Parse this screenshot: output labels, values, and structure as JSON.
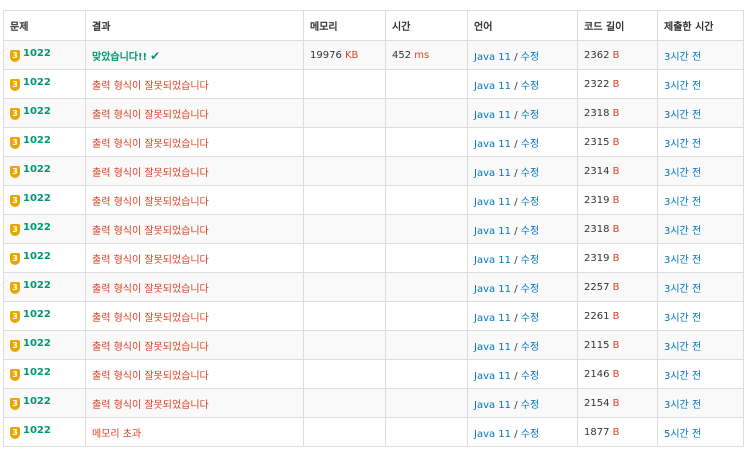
{
  "headers": [
    "문제",
    "결과",
    "메모리",
    "시간",
    "언어",
    "코드 길이",
    "제출한 시간"
  ],
  "tier_level": "3",
  "units": {
    "memory": "KB",
    "time": "ms",
    "code": "B"
  },
  "edit_label": "수정",
  "separator": "/",
  "check_icon": "check-icon",
  "rows": [
    {
      "problem": "1022",
      "result": "맞았습니다!!",
      "status": "ac",
      "memory": "19976",
      "time": "452",
      "language": "Java 11",
      "code_length": "2362",
      "submitted": "3시간 전"
    },
    {
      "problem": "1022",
      "result": "출력 형식이 잘못되었습니다",
      "status": "wa",
      "memory": "",
      "time": "",
      "language": "Java 11",
      "code_length": "2322",
      "submitted": "3시간 전"
    },
    {
      "problem": "1022",
      "result": "출력 형식이 잘못되었습니다",
      "status": "wa",
      "memory": "",
      "time": "",
      "language": "Java 11",
      "code_length": "2318",
      "submitted": "3시간 전"
    },
    {
      "problem": "1022",
      "result": "출력 형식이 잘못되었습니다",
      "status": "wa",
      "memory": "",
      "time": "",
      "language": "Java 11",
      "code_length": "2315",
      "submitted": "3시간 전"
    },
    {
      "problem": "1022",
      "result": "출력 형식이 잘못되었습니다",
      "status": "wa",
      "memory": "",
      "time": "",
      "language": "Java 11",
      "code_length": "2314",
      "submitted": "3시간 전"
    },
    {
      "problem": "1022",
      "result": "출력 형식이 잘못되었습니다",
      "status": "wa",
      "memory": "",
      "time": "",
      "language": "Java 11",
      "code_length": "2319",
      "submitted": "3시간 전"
    },
    {
      "problem": "1022",
      "result": "출력 형식이 잘못되었습니다",
      "status": "wa",
      "memory": "",
      "time": "",
      "language": "Java 11",
      "code_length": "2318",
      "submitted": "3시간 전"
    },
    {
      "problem": "1022",
      "result": "출력 형식이 잘못되었습니다",
      "status": "wa",
      "memory": "",
      "time": "",
      "language": "Java 11",
      "code_length": "2319",
      "submitted": "3시간 전"
    },
    {
      "problem": "1022",
      "result": "출력 형식이 잘못되었습니다",
      "status": "wa",
      "memory": "",
      "time": "",
      "language": "Java 11",
      "code_length": "2257",
      "submitted": "3시간 전"
    },
    {
      "problem": "1022",
      "result": "출력 형식이 잘못되었습니다",
      "status": "wa",
      "memory": "",
      "time": "",
      "language": "Java 11",
      "code_length": "2261",
      "submitted": "3시간 전"
    },
    {
      "problem": "1022",
      "result": "출력 형식이 잘못되었습니다",
      "status": "wa",
      "memory": "",
      "time": "",
      "language": "Java 11",
      "code_length": "2115",
      "submitted": "3시간 전"
    },
    {
      "problem": "1022",
      "result": "출력 형식이 잘못되었습니다",
      "status": "wa",
      "memory": "",
      "time": "",
      "language": "Java 11",
      "code_length": "2146",
      "submitted": "3시간 전"
    },
    {
      "problem": "1022",
      "result": "출력 형식이 잘못되었습니다",
      "status": "wa",
      "memory": "",
      "time": "",
      "language": "Java 11",
      "code_length": "2154",
      "submitted": "3시간 전"
    },
    {
      "problem": "1022",
      "result": "메모리 초과",
      "status": "wa",
      "memory": "",
      "time": "",
      "language": "Java 11",
      "code_length": "1877",
      "submitted": "5시간 전"
    }
  ]
}
